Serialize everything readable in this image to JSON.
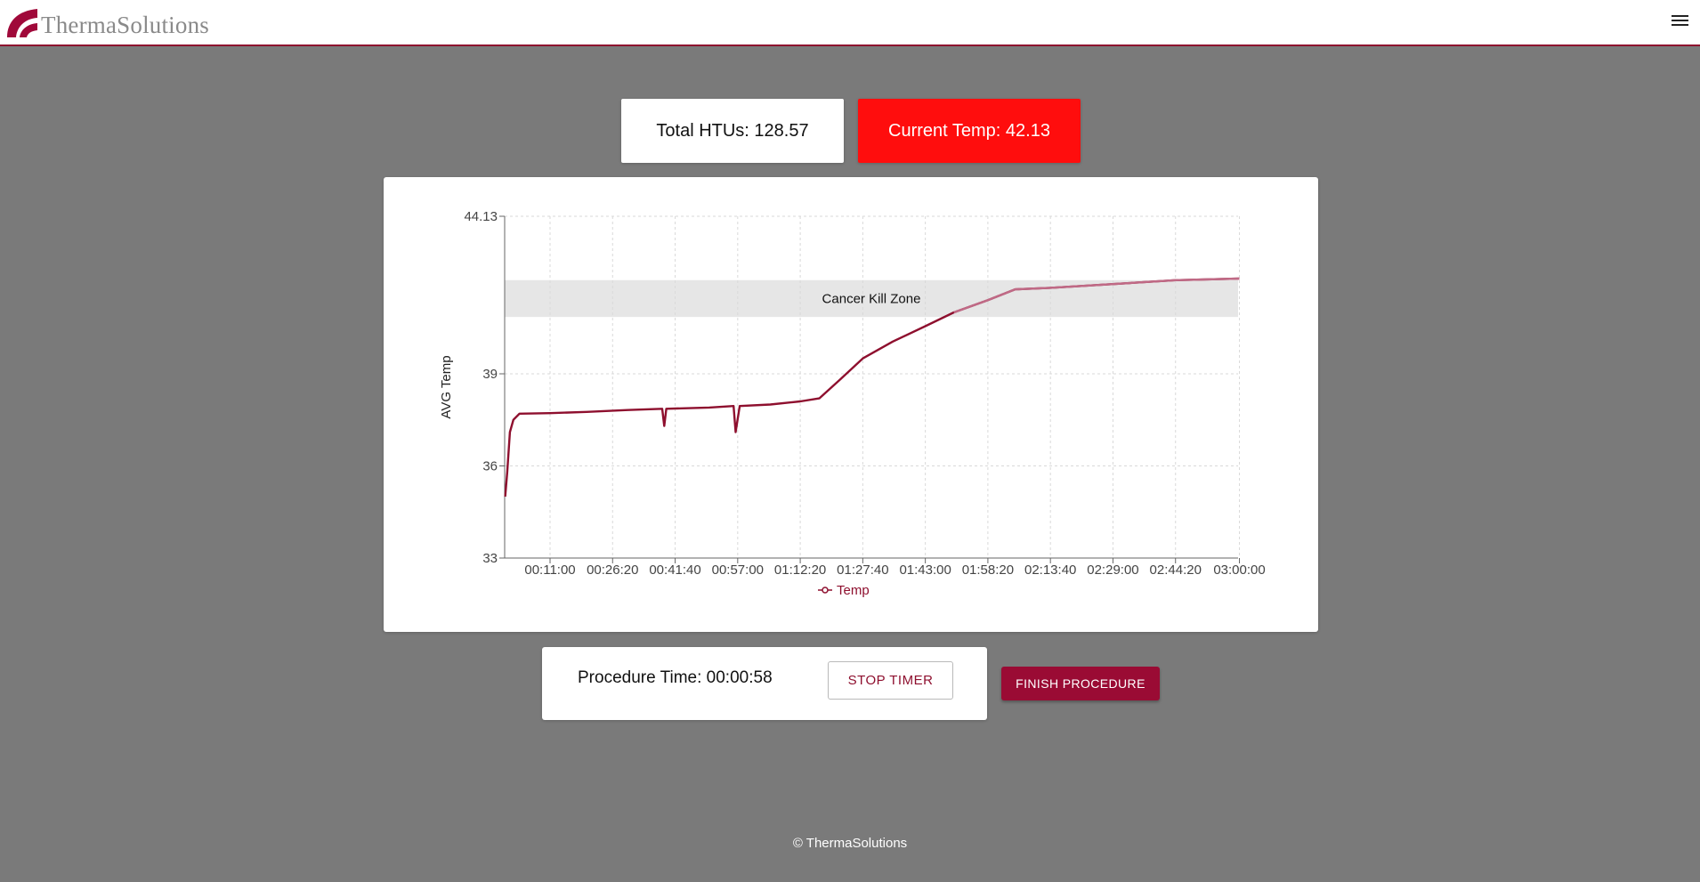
{
  "header": {
    "brand": "ThermaSolutions",
    "brand_color": "#a0093a"
  },
  "stats": {
    "total_htus": "Total HTUs: 128.57",
    "current_temp": "Current Temp: 42.13",
    "current_temp_color": "#ff0d0d"
  },
  "chart_data": {
    "type": "line",
    "ylabel": "AVG Temp",
    "xlabel": "",
    "ylim": [
      33,
      44.13
    ],
    "yticks": [
      "44.13",
      "39",
      "36",
      "33"
    ],
    "xticks": [
      "00:11:00",
      "00:26:20",
      "00:41:40",
      "00:57:00",
      "01:12:20",
      "01:27:40",
      "01:43:00",
      "01:58:20",
      "02:13:40",
      "02:29:00",
      "02:44:20",
      "03:00:00"
    ],
    "band": {
      "label": "Cancer Kill Zone",
      "from": 40.85,
      "to": 42.05
    },
    "grid": true,
    "legend": "bottom",
    "series": [
      {
        "name": "Temp",
        "color": "#8e0f2e",
        "points": [
          [
            "00:00:00",
            35.0
          ],
          [
            "00:00:30",
            35.8
          ],
          [
            "00:01:10",
            37.1
          ],
          [
            "00:02:00",
            37.5
          ],
          [
            "00:03:30",
            37.7
          ],
          [
            "00:11:00",
            37.72
          ],
          [
            "00:20:00",
            37.76
          ],
          [
            "00:30:00",
            37.82
          ],
          [
            "00:38:30",
            37.86
          ],
          [
            "00:39:00",
            37.3
          ],
          [
            "00:39:30",
            37.86
          ],
          [
            "00:50:00",
            37.9
          ],
          [
            "00:56:00",
            37.95
          ],
          [
            "00:56:30",
            37.1
          ],
          [
            "00:57:30",
            37.95
          ],
          [
            "01:05:00",
            38.0
          ],
          [
            "01:12:20",
            38.1
          ],
          [
            "01:17:00",
            38.2
          ],
          [
            "01:22:00",
            38.8
          ],
          [
            "01:27:40",
            39.5
          ],
          [
            "01:35:00",
            40.05
          ],
          [
            "01:43:00",
            40.55
          ],
          [
            "01:50:00",
            41.0
          ],
          [
            "01:58:20",
            41.4
          ],
          [
            "02:05:00",
            41.75
          ],
          [
            "02:13:40",
            41.8
          ],
          [
            "02:29:00",
            41.92
          ],
          [
            "02:44:20",
            42.05
          ],
          [
            "03:00:00",
            42.1
          ]
        ]
      }
    ]
  },
  "timer": {
    "label": "Procedure Time: 00:00:58",
    "stop_label": "STOP TIMER"
  },
  "actions": {
    "finish_label": "FINISH PROCEDURE",
    "finish_color": "#9a0b34"
  },
  "footer": {
    "copyright": "© ThermaSolutions"
  }
}
